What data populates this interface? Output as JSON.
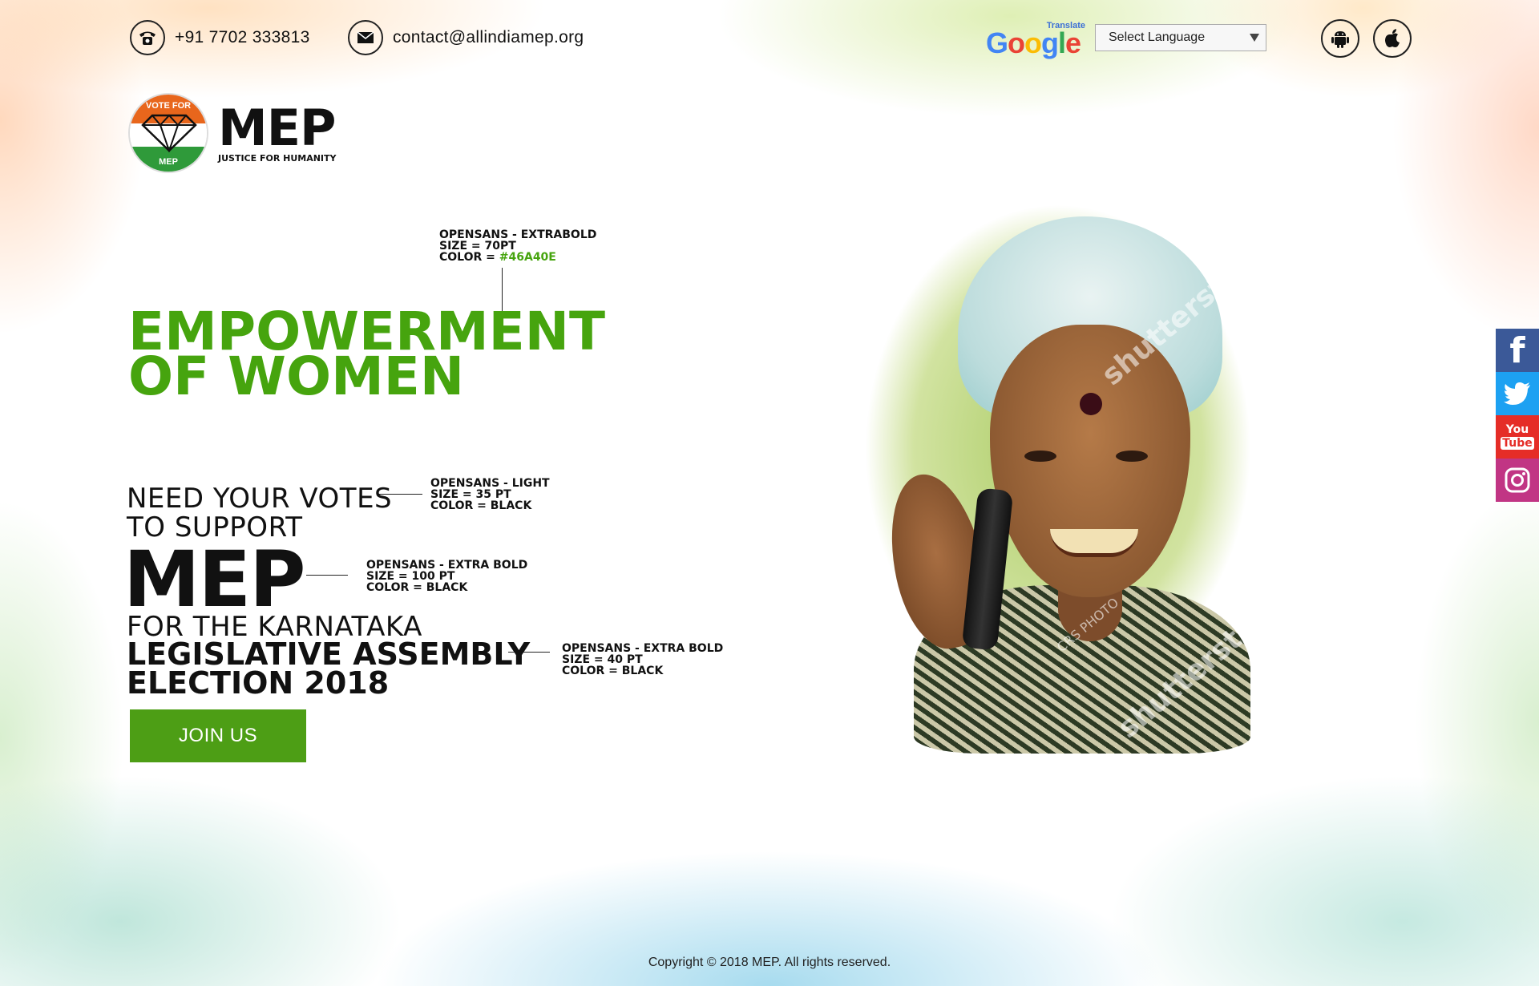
{
  "header": {
    "phone": "+91 7702 333813",
    "email": "contact@allindiamep.org",
    "translate_label": "Translate",
    "google_letters": [
      {
        "ch": "G",
        "color": "#4285F4"
      },
      {
        "ch": "o",
        "color": "#EA4335"
      },
      {
        "ch": "o",
        "color": "#FBBC05"
      },
      {
        "ch": "g",
        "color": "#4285F4"
      },
      {
        "ch": "l",
        "color": "#34A853"
      },
      {
        "ch": "e",
        "color": "#EA4335"
      }
    ],
    "language_select": "Select Language",
    "app_icons": [
      "android-icon",
      "apple-icon"
    ]
  },
  "logo": {
    "badge_top": "VOTE FOR",
    "badge_bottom": "MEP",
    "word": "MEP",
    "tagline": "JUSTICE FOR HUMANITY",
    "colors": {
      "saffron": "#e8661c",
      "green": "#2f9a3a"
    }
  },
  "hero": {
    "headline_line1": "EMPOWERMENT",
    "headline_line2": "OF WOMEN",
    "headline_color": "#46A40E",
    "need_line1": "NEED YOUR VOTES",
    "need_line2": "TO SUPPORT",
    "mep": "MEP",
    "for_line": "FOR THE KARNATAKA",
    "assembly_line1": "LEGISLATIVE ASSEMBLY",
    "assembly_line2": "ELECTION 2018",
    "join_button": "JOIN US",
    "button_color": "#4d9e15"
  },
  "annotations": {
    "headline": {
      "line1": "OPENSANS - EXTRABOLD",
      "line2": "SIZE = 70PT",
      "line3_prefix": "COLOR = ",
      "line3_value": "#46A40E"
    },
    "need": {
      "line1": "OPENSANS - LIGHT",
      "line2": "SIZE = 35 PT",
      "line3": "COLOR = BLACK"
    },
    "mep": {
      "line1": "OPENSANS - EXTRA BOLD",
      "line2": "SIZE = 100 PT",
      "line3": "COLOR = BLACK"
    },
    "assembly": {
      "line1": "OPENSANS - EXTRA BOLD",
      "line2": "SIZE = 40 PT",
      "line3": "COLOR = BLACK"
    }
  },
  "photo": {
    "watermark_main": "shutterstock",
    "watermark_small": "CRS PHOTO"
  },
  "social": [
    {
      "name": "facebook",
      "label": "f",
      "color": "#3b5998"
    },
    {
      "name": "twitter",
      "label": "",
      "color": "#1da1f2"
    },
    {
      "name": "youtube",
      "label_top": "You",
      "label_bottom": "Tube",
      "color": "#e52d27"
    },
    {
      "name": "instagram",
      "label": "",
      "color": "#c13584"
    }
  ],
  "footer": {
    "copyright": "Copyright © 2018 MEP.  All rights reserved."
  }
}
